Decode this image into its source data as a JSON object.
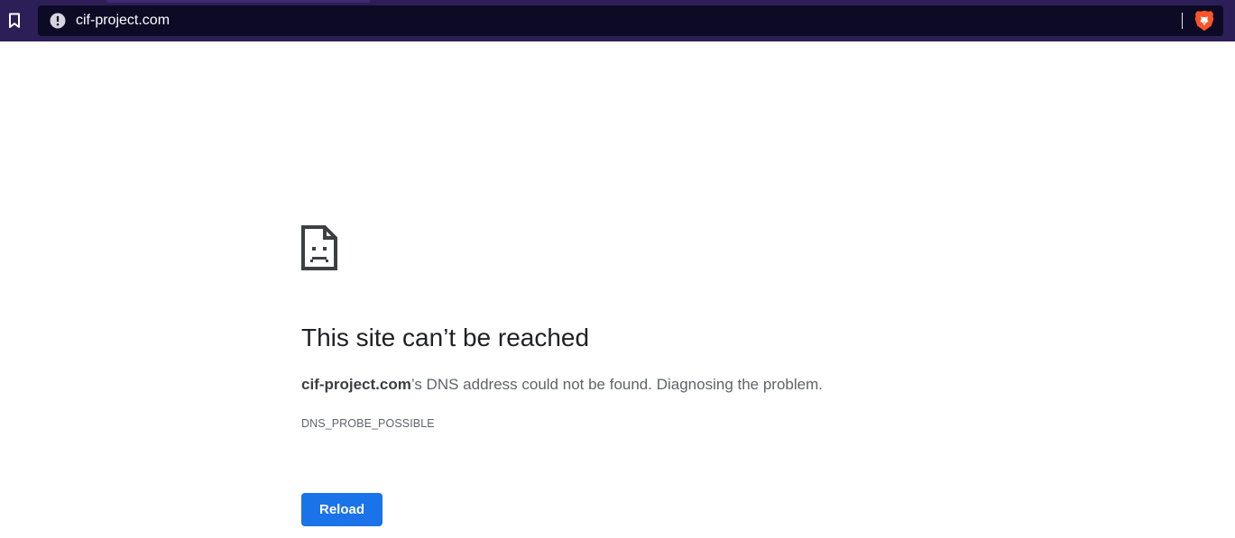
{
  "browser": {
    "address_bar": {
      "url": "cif-project.com",
      "security_icon": "info-warning-icon"
    },
    "bookmark_icon": "bookmark-icon",
    "shield_icon": "brave-shield-icon",
    "colors": {
      "toolbar": "#2c1e57",
      "omnibox": "#0d0a26",
      "url_text": "#ffffff"
    }
  },
  "error_page": {
    "icon": "sad-document-icon",
    "title": "This site can’t be reached",
    "message": {
      "host": "cif-project.com",
      "rest": "’s DNS address could not be found. Diagnosing the problem."
    },
    "error_code": "DNS_PROBE_POSSIBLE",
    "reload_label": "Reload",
    "colors": {
      "title": "#202124",
      "body": "#5f6368",
      "button": "#1a73e8"
    }
  }
}
